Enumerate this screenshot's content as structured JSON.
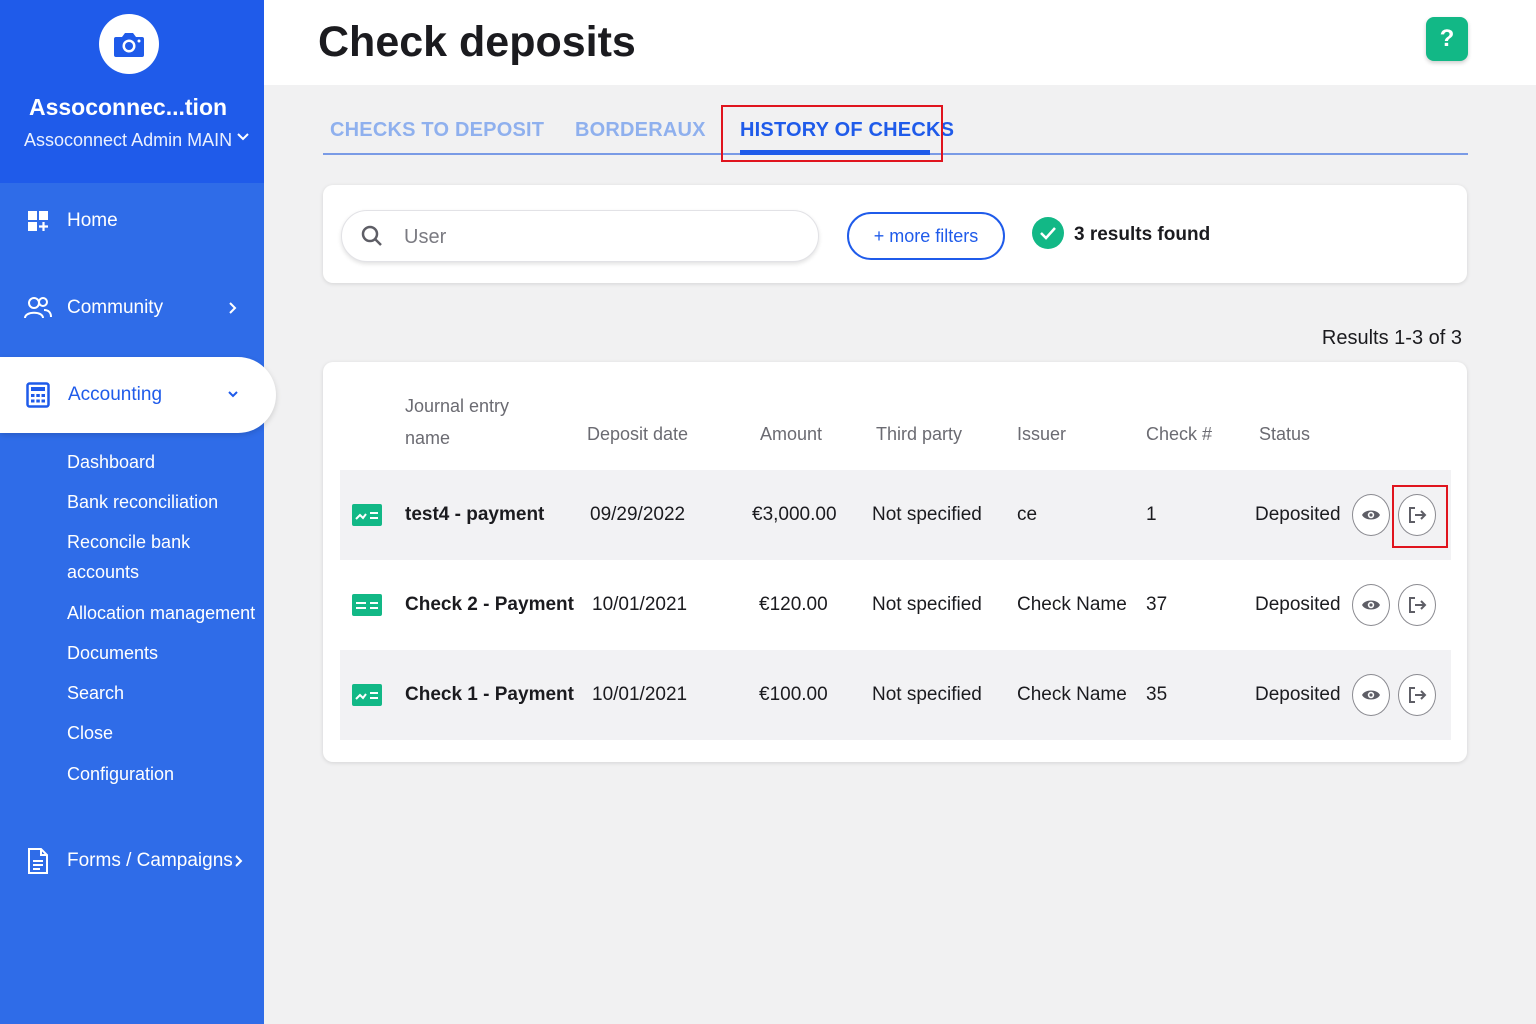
{
  "sidebar": {
    "org_name": "Assoconnec...tion",
    "org_sub": "Assoconnect Admin MAIN",
    "nav": [
      {
        "label": "Home",
        "icon": "home-grid-icon"
      },
      {
        "label": "Community",
        "icon": "community-icon"
      },
      {
        "label": "Accounting",
        "icon": "calculator-icon"
      },
      {
        "label": "Forms / Campaigns",
        "icon": "document-icon"
      }
    ],
    "accounting_sub": [
      "Dashboard",
      "Bank reconciliation",
      "Reconcile bank",
      "accounts",
      "Allocation management",
      "Documents",
      "Search",
      "Close",
      "Configuration"
    ]
  },
  "header": {
    "title": "Check deposits",
    "help": "?"
  },
  "tabs": [
    {
      "label": "CHECKS TO DEPOSIT"
    },
    {
      "label": "BORDERAUX"
    },
    {
      "label": "HISTORY OF CHECKS"
    }
  ],
  "filters": {
    "search_placeholder": "User",
    "more_filters": "+ more filters",
    "results_found": "3 results found"
  },
  "results_count": "Results 1-3 of 3",
  "table": {
    "columns": [
      "Journal entry",
      "name",
      "Deposit date",
      "Amount",
      "Third party",
      "Issuer",
      "Check #",
      "Status"
    ],
    "rows": [
      {
        "name": "test4 - payment",
        "date": "09/29/2022",
        "amount": "€3,000.00",
        "third_party": "Not specified",
        "issuer": "ce",
        "check": "1",
        "status": "Deposited"
      },
      {
        "name": "Check 2 - Payment",
        "date": "10/01/2021",
        "amount": "€120.00",
        "third_party": "Not specified",
        "issuer": "Check Name",
        "check": "37",
        "status": "Deposited"
      },
      {
        "name": "Check 1 - Payment",
        "date": "10/01/2021",
        "amount": "€100.00",
        "third_party": "Not specified",
        "issuer": "Check Name",
        "check": "35",
        "status": "Deposited"
      }
    ]
  },
  "colors": {
    "primary": "#1f5bea",
    "sidebar": "#2f6ce8",
    "success": "#12b886",
    "highlight": "#e0141e"
  }
}
